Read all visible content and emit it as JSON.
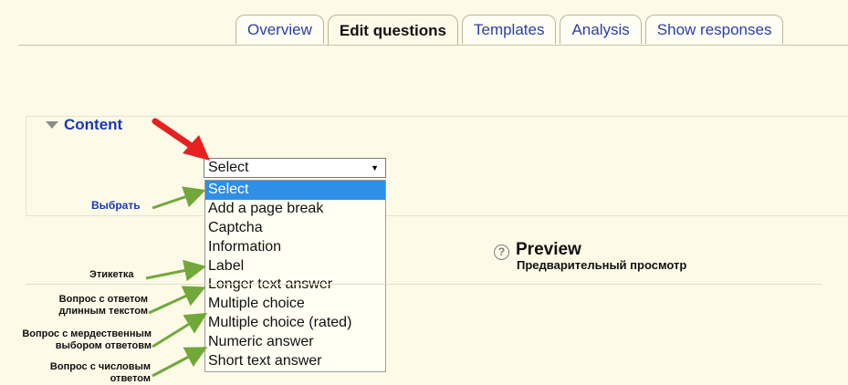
{
  "tabs": [
    {
      "label": "Overview",
      "active": false
    },
    {
      "label": "Edit questions",
      "active": true
    },
    {
      "label": "Templates",
      "active": false
    },
    {
      "label": "Analysis",
      "active": false
    },
    {
      "label": "Show responses",
      "active": false
    }
  ],
  "content": {
    "legend": "Content"
  },
  "select": {
    "value": "Select",
    "options": [
      {
        "label": "Select",
        "highlighted": true
      },
      {
        "label": "Add a page break",
        "highlighted": false
      },
      {
        "label": "Captcha",
        "highlighted": false
      },
      {
        "label": "Information",
        "highlighted": false
      },
      {
        "label": "Label",
        "highlighted": false
      },
      {
        "label": "Longer text answer",
        "highlighted": false
      },
      {
        "label": "Multiple choice",
        "highlighted": false
      },
      {
        "label": "Multiple choice (rated)",
        "highlighted": false
      },
      {
        "label": "Numeric answer",
        "highlighted": false
      },
      {
        "label": "Short text answer",
        "highlighted": false
      }
    ]
  },
  "preview": {
    "title": "Preview",
    "subtitle": "Предварительный просмотр"
  },
  "annotations": {
    "select": "Выбрать",
    "label": "Этикетка",
    "longer_text_1": "Вопрос с ответом",
    "longer_text_2": "длинным текстом",
    "rated_1": "Вопрос с мердественным",
    "rated_2": "выбором ответовм",
    "numeric_1": "Вопрос с числовым",
    "numeric_2": "ответом"
  },
  "colors": {
    "tab_link": "#2a3fa8",
    "legend": "#1a37b8",
    "highlight": "#2f8ee6",
    "pointer_arrow": "#e52121",
    "annotation_arrow": "#72a83a",
    "background": "#fdfbe8"
  }
}
